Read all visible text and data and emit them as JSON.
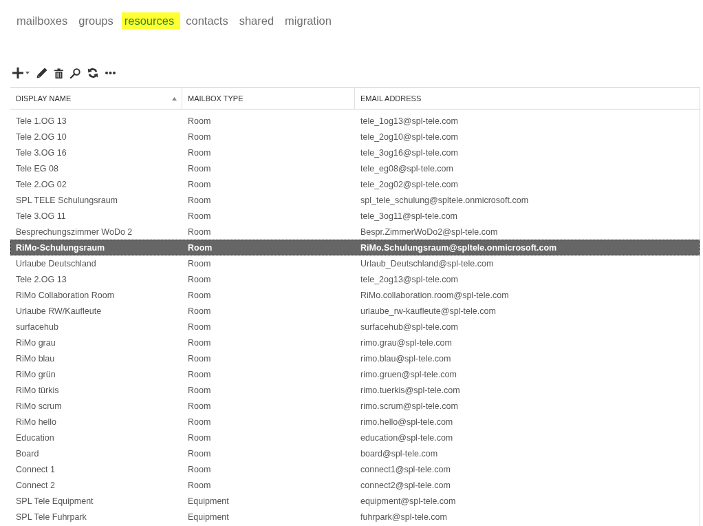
{
  "nav_tabs": [
    {
      "label": "mailboxes",
      "selected": false,
      "highlighted": false
    },
    {
      "label": "groups",
      "selected": false,
      "highlighted": false
    },
    {
      "label": "resources",
      "selected": true,
      "highlighted": true
    },
    {
      "label": "contacts",
      "selected": false,
      "highlighted": false
    },
    {
      "label": "shared",
      "selected": false,
      "highlighted": false
    },
    {
      "label": "migration",
      "selected": false,
      "highlighted": false
    }
  ],
  "table": {
    "columns": [
      {
        "label": "DISPLAY NAME",
        "sorted": true
      },
      {
        "label": "MAILBOX TYPE",
        "sorted": false
      },
      {
        "label": "EMAIL ADDRESS",
        "sorted": false
      }
    ],
    "rows": [
      {
        "display_name": "Tele 1.OG 13",
        "mailbox_type": "Room",
        "email_address": "tele_1og13@spl-tele.com",
        "selected": false
      },
      {
        "display_name": "Tele 2.OG 10",
        "mailbox_type": "Room",
        "email_address": "tele_2og10@spl-tele.com",
        "selected": false
      },
      {
        "display_name": "Tele 3.OG 16",
        "mailbox_type": "Room",
        "email_address": "tele_3og16@spl-tele.com",
        "selected": false
      },
      {
        "display_name": "Tele EG 08",
        "mailbox_type": "Room",
        "email_address": "tele_eg08@spl-tele.com",
        "selected": false
      },
      {
        "display_name": "Tele 2.OG 02",
        "mailbox_type": "Room",
        "email_address": "tele_2og02@spl-tele.com",
        "selected": false
      },
      {
        "display_name": "SPL TELE Schulungsraum",
        "mailbox_type": "Room",
        "email_address": "spl_tele_schulung@spltele.onmicrosoft.com",
        "selected": false
      },
      {
        "display_name": "Tele 3.OG 11",
        "mailbox_type": "Room",
        "email_address": "tele_3og11@spl-tele.com",
        "selected": false
      },
      {
        "display_name": "Besprechungszimmer WoDo 2",
        "mailbox_type": "Room",
        "email_address": "Bespr.ZimmerWoDo2@spl-tele.com",
        "selected": false
      },
      {
        "display_name": "RiMo-Schulungsraum",
        "mailbox_type": "Room",
        "email_address": "RiMo.Schulungsraum@spltele.onmicrosoft.com",
        "selected": true
      },
      {
        "display_name": "Urlaube Deutschland",
        "mailbox_type": "Room",
        "email_address": "Urlaub_Deutschland@spl-tele.com",
        "selected": false
      },
      {
        "display_name": "Tele 2.OG 13",
        "mailbox_type": "Room",
        "email_address": "tele_2og13@spl-tele.com",
        "selected": false
      },
      {
        "display_name": "RiMo Collaboration Room",
        "mailbox_type": "Room",
        "email_address": "RiMo.collaboration.room@spl-tele.com",
        "selected": false
      },
      {
        "display_name": "Urlaube RW/Kaufleute",
        "mailbox_type": "Room",
        "email_address": "urlaube_rw-kaufleute@spl-tele.com",
        "selected": false
      },
      {
        "display_name": "surfacehub",
        "mailbox_type": "Room",
        "email_address": "surfacehub@spl-tele.com",
        "selected": false
      },
      {
        "display_name": "RiMo grau",
        "mailbox_type": "Room",
        "email_address": "rimo.grau@spl-tele.com",
        "selected": false
      },
      {
        "display_name": "RiMo blau",
        "mailbox_type": "Room",
        "email_address": "rimo.blau@spl-tele.com",
        "selected": false
      },
      {
        "display_name": "RiMo grün",
        "mailbox_type": "Room",
        "email_address": "rimo.gruen@spl-tele.com",
        "selected": false
      },
      {
        "display_name": "RiMo türkis",
        "mailbox_type": "Room",
        "email_address": "rimo.tuerkis@spl-tele.com",
        "selected": false
      },
      {
        "display_name": "RiMo scrum",
        "mailbox_type": "Room",
        "email_address": "rimo.scrum@spl-tele.com",
        "selected": false
      },
      {
        "display_name": "RiMo hello",
        "mailbox_type": "Room",
        "email_address": "rimo.hello@spl-tele.com",
        "selected": false
      },
      {
        "display_name": "Education",
        "mailbox_type": "Room",
        "email_address": "education@spl-tele.com",
        "selected": false
      },
      {
        "display_name": "Board",
        "mailbox_type": "Room",
        "email_address": "board@spl-tele.com",
        "selected": false
      },
      {
        "display_name": "Connect 1",
        "mailbox_type": "Room",
        "email_address": "connect1@spl-tele.com",
        "selected": false
      },
      {
        "display_name": "Connect 2",
        "mailbox_type": "Room",
        "email_address": "connect2@spl-tele.com",
        "selected": false
      },
      {
        "display_name": "SPL Tele Equipment",
        "mailbox_type": "Equipment",
        "email_address": "equipment@spl-tele.com",
        "selected": false
      },
      {
        "display_name": "SPL Tele Fuhrpark",
        "mailbox_type": "Equipment",
        "email_address": "fuhrpark@spl-tele.com",
        "selected": false
      }
    ]
  }
}
